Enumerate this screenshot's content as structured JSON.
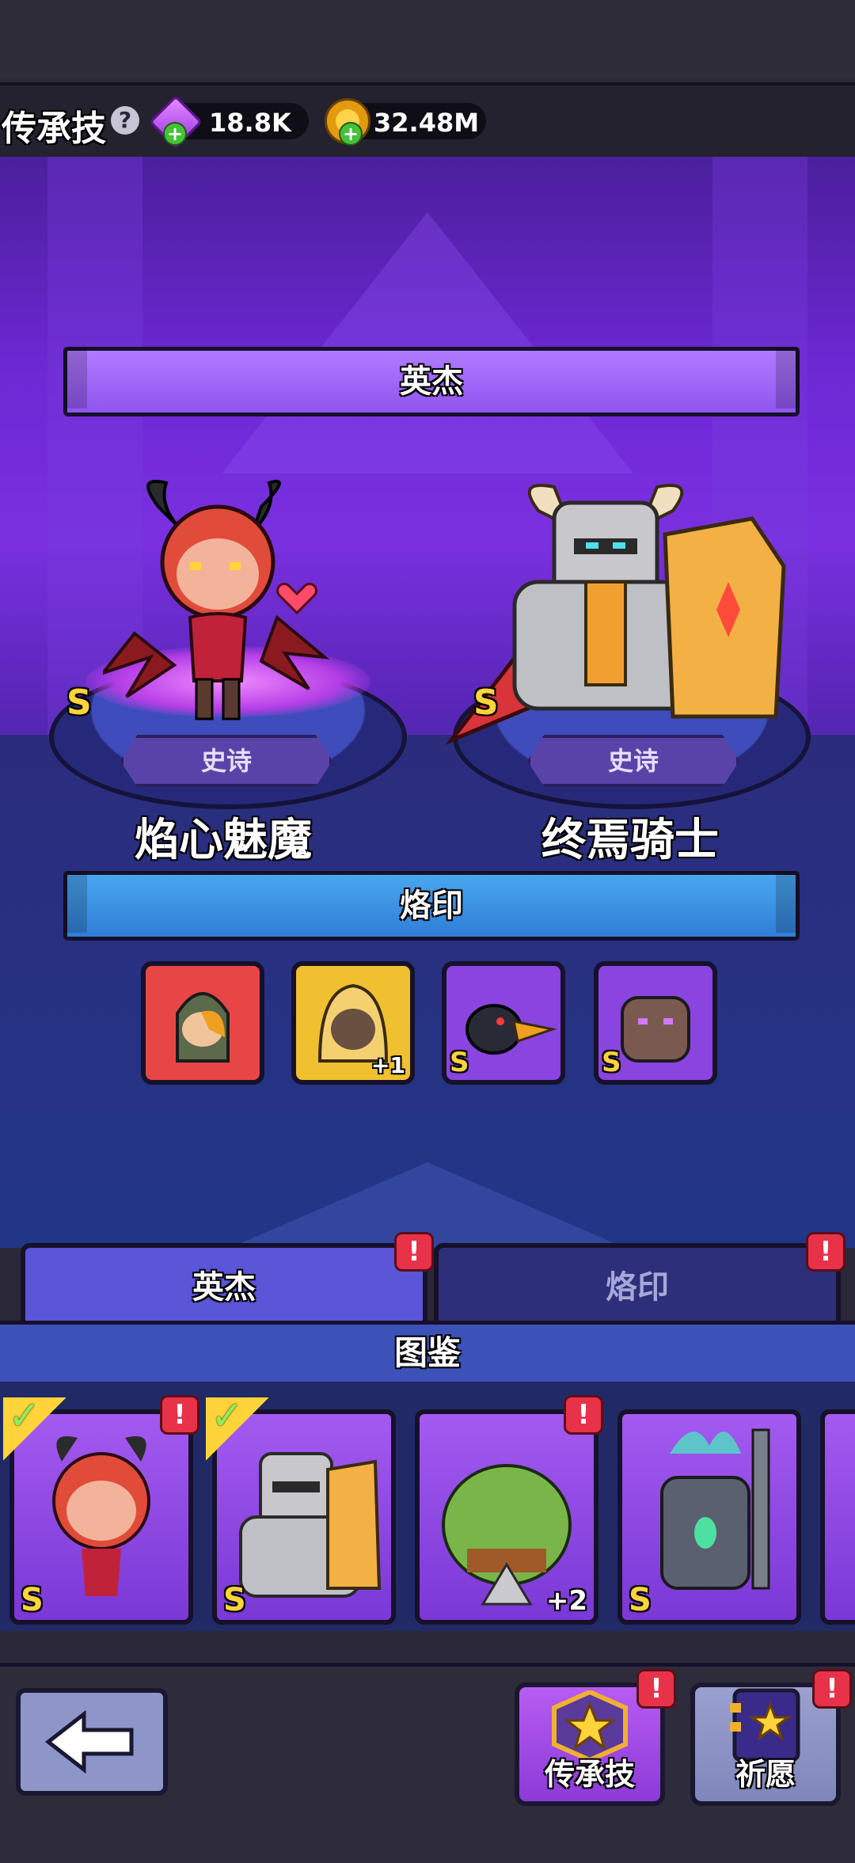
{
  "top": {
    "title": "传承技",
    "help_icon": "?",
    "gems": "18.8K",
    "coins": "32.48M",
    "plus": "+"
  },
  "section_hero": {
    "banner": "英杰"
  },
  "heroes": [
    {
      "rarity": "史诗",
      "grade": "S",
      "name": "焰心魅魔"
    },
    {
      "rarity": "史诗",
      "grade": "S",
      "name": "终焉骑士"
    }
  ],
  "section_emblem": {
    "banner": "烙印"
  },
  "emblems": [
    {
      "grade": "",
      "plus": ""
    },
    {
      "grade": "",
      "plus": "+1"
    },
    {
      "grade": "S",
      "plus": ""
    },
    {
      "grade": "S",
      "plus": ""
    }
  ],
  "tabs": {
    "hero": "英杰",
    "emblem": "烙印",
    "alert": "!"
  },
  "codex": {
    "title": "图鉴",
    "cards": [
      {
        "grade": "S",
        "plus": ""
      },
      {
        "grade": "S",
        "plus": ""
      },
      {
        "grade": "",
        "plus": "+2"
      },
      {
        "grade": "S",
        "plus": ""
      }
    ]
  },
  "bottom": {
    "legacy_label": "传承技",
    "wish_label": "祈愿",
    "alert": "!"
  },
  "colors": {
    "accent_purple": "#9b5cf5",
    "accent_blue": "#3a8de6",
    "gold": "#ffd43a",
    "alert_red": "#e8324a"
  }
}
